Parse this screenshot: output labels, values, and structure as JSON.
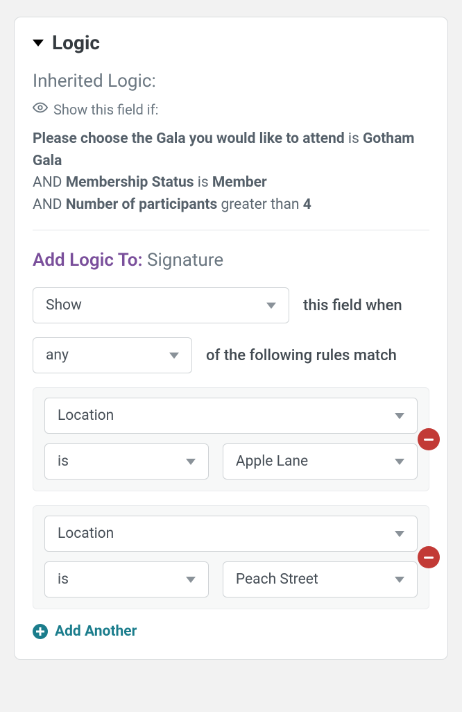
{
  "section": {
    "title": "Logic"
  },
  "inherited": {
    "heading": "Inherited Logic:",
    "show_if_label": "Show this field if:",
    "rules": [
      {
        "field": "Please choose the Gala you would like to attend",
        "op": "is",
        "value": "Gotham Gala"
      },
      {
        "conj": "AND",
        "field": "Membership Status",
        "op": "is",
        "value": "Member"
      },
      {
        "conj": "AND",
        "field": "Number of participants",
        "op": "greater than",
        "value": "4"
      }
    ]
  },
  "add_logic": {
    "label": "Add Logic To:",
    "target": "Signature",
    "action_select": "Show",
    "action_suffix": "this field when",
    "match_select": "any",
    "match_suffix": "of the following rules match",
    "rules": [
      {
        "field": "Location",
        "op": "is",
        "value": "Apple Lane"
      },
      {
        "field": "Location",
        "op": "is",
        "value": "Peach Street"
      }
    ],
    "add_another_label": "Add Another"
  }
}
